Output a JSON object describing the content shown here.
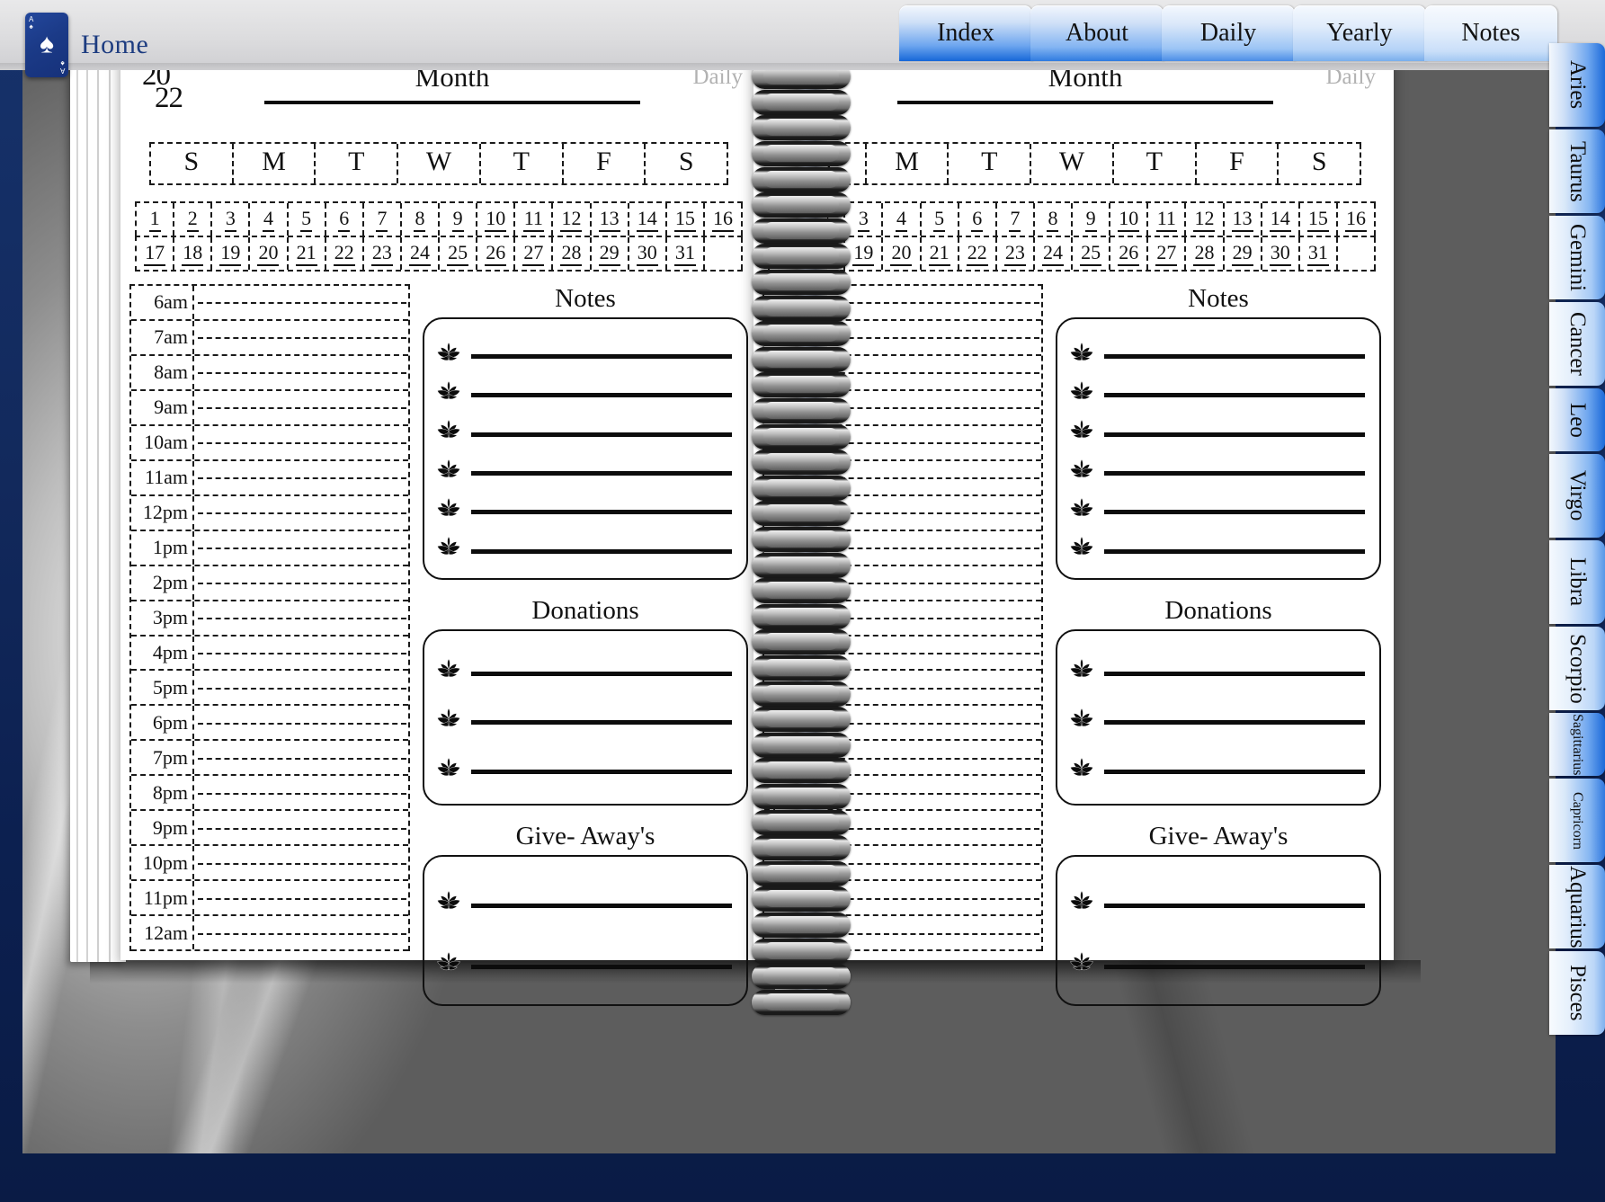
{
  "toolbar": {
    "home_label": "Home",
    "card_icon": "ace-of-spades-icon",
    "card_corner_rank": "A",
    "card_corner_suit": "♠",
    "card_pip": "♠",
    "tabs": [
      {
        "label": "Index"
      },
      {
        "label": "About"
      },
      {
        "label": "Daily"
      },
      {
        "label": "Yearly"
      },
      {
        "label": "Notes"
      }
    ]
  },
  "zodiac_tabs": [
    {
      "label": "Aries"
    },
    {
      "label": "Taurus"
    },
    {
      "label": "Gemini"
    },
    {
      "label": "Cancer"
    },
    {
      "label": "Leo"
    },
    {
      "label": "Virgo"
    },
    {
      "label": "Libra"
    },
    {
      "label": "Scorpio"
    },
    {
      "label": "Sagittarius"
    },
    {
      "label": "Capricorn"
    },
    {
      "label": "Aquarius"
    },
    {
      "label": "Pisces"
    }
  ],
  "page": {
    "year_top": "20",
    "year_bottom": "22",
    "month_label": "Month",
    "corner_tag": "Daily",
    "weekdays": [
      "S",
      "M",
      "T",
      "W",
      "T",
      "F",
      "S"
    ],
    "dates_row1": [
      "1",
      "2",
      "3",
      "4",
      "5",
      "6",
      "7",
      "8",
      "9",
      "10",
      "11",
      "12",
      "13",
      "14",
      "15",
      "16"
    ],
    "dates_row2": [
      "17",
      "18",
      "19",
      "20",
      "21",
      "22",
      "23",
      "24",
      "25",
      "26",
      "27",
      "28",
      "29",
      "30",
      "31"
    ],
    "hours": [
      "6am",
      "7am",
      "8am",
      "9am",
      "10am",
      "11am",
      "12pm",
      "1pm",
      "2pm",
      "3pm",
      "4pm",
      "5pm",
      "6pm",
      "7pm",
      "8pm",
      "9pm",
      "10pm",
      "11pm",
      "12am"
    ],
    "panels": [
      {
        "title": "Notes",
        "rows": 6,
        "bullet_icon": "lotus-icon"
      },
      {
        "title": "Donations",
        "rows": 3,
        "bullet_icon": "lotus-icon"
      },
      {
        "title": "Give- Away's",
        "rows": 2,
        "bullet_icon": "lotus-icon"
      }
    ]
  },
  "colors": {
    "app_background": "#12295c",
    "tab_blue": "#1667d8",
    "home_text": "#1d3c80",
    "ink": "#111111",
    "corner_tag": "#b2b2b2"
  }
}
